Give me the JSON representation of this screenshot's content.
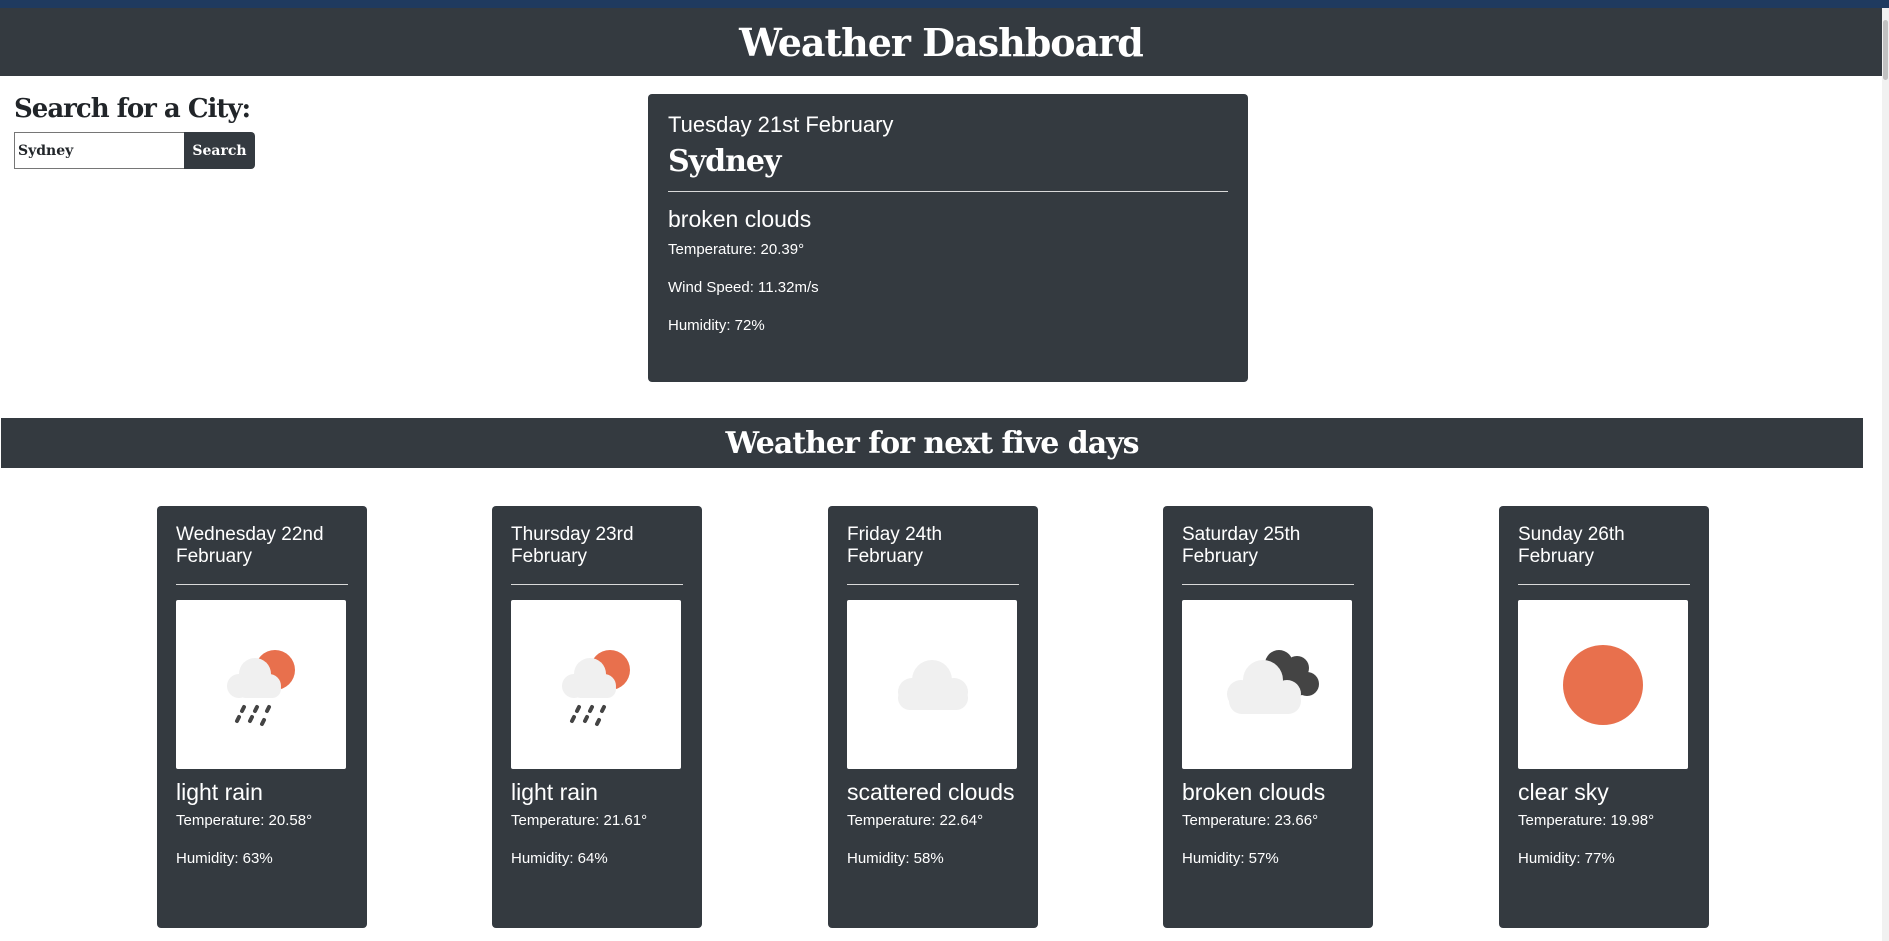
{
  "header": {
    "title": "Weather Dashboard"
  },
  "search": {
    "title": "Search for a City:",
    "input_value": "Sydney",
    "button_label": "Search"
  },
  "current": {
    "date": "Tuesday 21st February",
    "city": "Sydney",
    "description": "broken clouds",
    "temperature": "Temperature: 20.39°",
    "wind": "Wind Speed: 11.32m/s",
    "humidity": "Humidity: 72%"
  },
  "forecast": {
    "title": "Weather for next five days",
    "days": [
      {
        "date": "Wednesday 22nd February",
        "icon": "light-rain-icon",
        "description": "light rain",
        "temperature": "Temperature: 20.58°",
        "humidity": "Humidity: 63%"
      },
      {
        "date": "Thursday 23rd February",
        "icon": "light-rain-icon",
        "description": "light rain",
        "temperature": "Temperature: 21.61°",
        "humidity": "Humidity: 64%"
      },
      {
        "date": "Friday 24th February",
        "icon": "scattered-clouds-icon",
        "description": "scattered clouds",
        "temperature": "Temperature: 22.64°",
        "humidity": "Humidity: 58%"
      },
      {
        "date": "Saturday 25th February",
        "icon": "broken-clouds-icon",
        "description": "broken clouds",
        "temperature": "Temperature: 23.66°",
        "humidity": "Humidity: 57%"
      },
      {
        "date": "Sunday 26th February",
        "icon": "clear-sky-icon",
        "description": "clear sky",
        "temperature": "Temperature: 19.98°",
        "humidity": "Humidity: 77%"
      }
    ]
  },
  "colors": {
    "panel": "#343a40",
    "sun": "#e8704d",
    "cloud_light": "#f0f0f0",
    "cloud_dark": "#444444"
  }
}
